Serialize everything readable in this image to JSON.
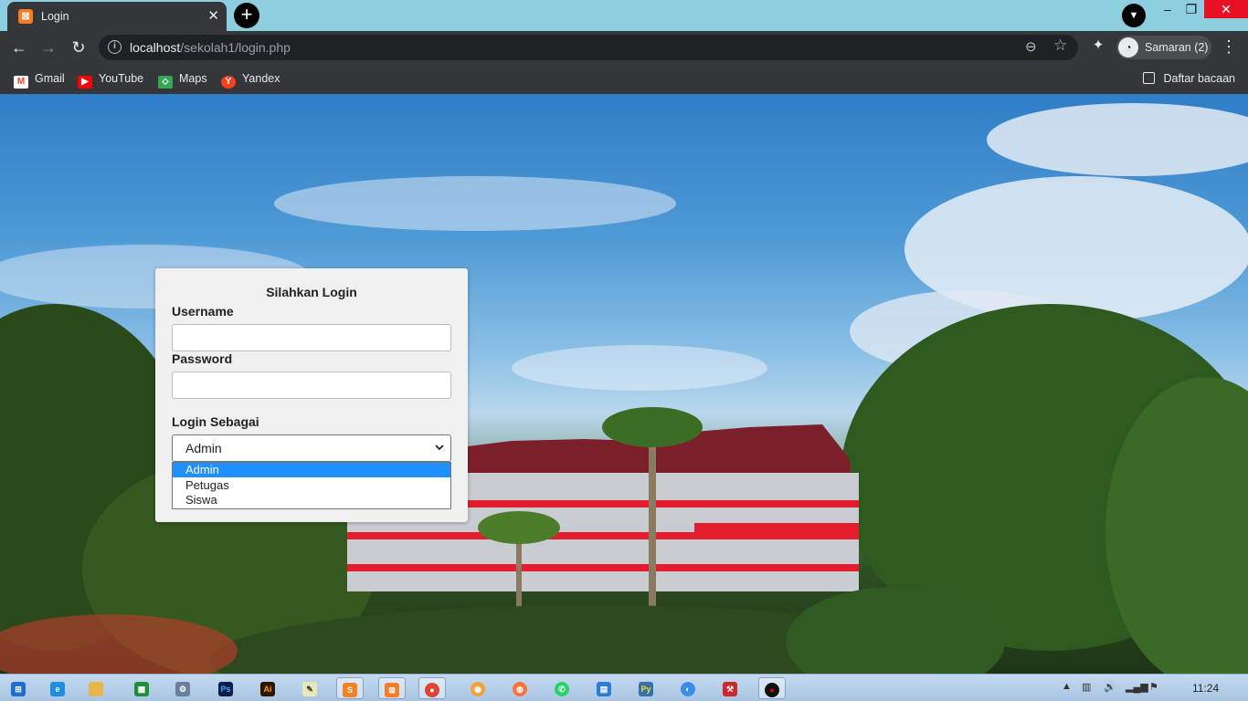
{
  "browser": {
    "tab_title": "Login",
    "url_host": "localhost",
    "url_path": "/sekolah1/login.php",
    "profile_label": "Samaran (2)",
    "bookmarks": [
      "Gmail",
      "YouTube",
      "Maps",
      "Yandex"
    ],
    "reading_list": "Daftar bacaan"
  },
  "login": {
    "heading": "Silahkan Login",
    "username_label": "Username",
    "password_label": "Password",
    "role_label": "Login Sebagai",
    "role_selected": "Admin",
    "role_options": [
      "Admin",
      "Petugas",
      "Siswa"
    ]
  },
  "taskbar": {
    "clock": "11:24"
  },
  "colors": {
    "tabstrip": "#8ecfdf",
    "chrome_dark": "#35363a",
    "close_red": "#e81123",
    "option_highlight": "#1e90ff"
  }
}
